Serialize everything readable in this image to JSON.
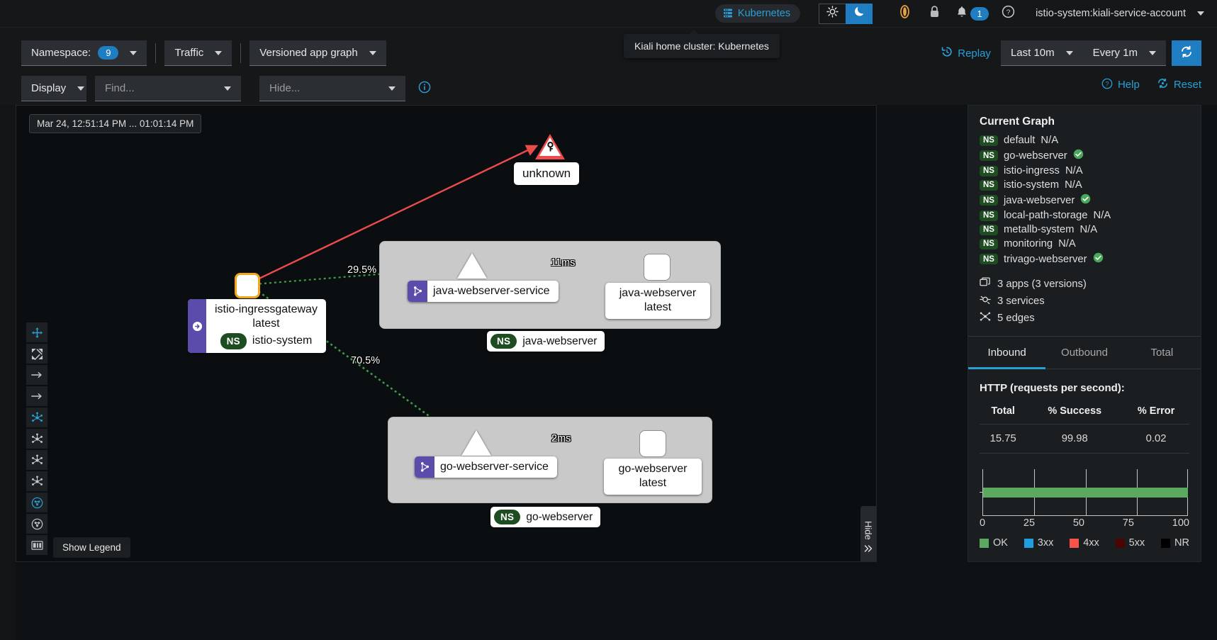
{
  "masthead": {
    "cluster_chip": "Kubernetes",
    "cluster_tooltip": "Kiali home cluster: Kubernetes",
    "theme_light_icon": "sun-icon",
    "theme_dark_icon": "moon-icon",
    "status_icon": "istio-status-icon",
    "lock_icon": "lock-icon",
    "bell_icon": "bell-icon",
    "notification_count": "1",
    "help_icon": "question-circle-icon",
    "user": "istio-system:kiali-service-account"
  },
  "toolbar": {
    "namespace_label": "Namespace:",
    "namespace_count": "9",
    "traffic_label": "Traffic",
    "graph_type": "Versioned app graph",
    "display_label": "Display",
    "find_placeholder": "Find...",
    "hide_placeholder": "Hide...",
    "info_icon": "info-circle-icon",
    "replay_label": "Replay",
    "duration": "Last 10m",
    "refresh_interval": "Every 1m",
    "refresh_icon": "sync-icon",
    "help_label": "Help",
    "reset_label": "Reset"
  },
  "graph": {
    "time_range_chip": "Mar 24, 12:51:14 PM ... 01:01:14 PM",
    "tools": [
      {
        "name": "drag-mode-button",
        "icon": "arrows-move-icon",
        "active": true
      },
      {
        "name": "fit-to-screen-button",
        "icon": "expand-icon",
        "active": false
      },
      {
        "name": "layout-dagre-lr-button",
        "icon": "arrow-right-icon",
        "active": false
      },
      {
        "name": "layout-grid-button",
        "icon": "arrow-right-icon",
        "active": false
      },
      {
        "name": "layout-cola-button",
        "icon": "topology-icon",
        "active": true
      },
      {
        "name": "layout-dagre-button",
        "icon": "topology-icon",
        "active": false
      },
      {
        "name": "layout-grid2-button",
        "icon": "topology-icon",
        "active": false
      },
      {
        "name": "layout-concentric-button",
        "icon": "topology-icon",
        "active": false
      },
      {
        "name": "namespace-layout-button",
        "icon": "circle-topology-icon",
        "active": true
      },
      {
        "name": "namespace-layout2-button",
        "icon": "circle-topology-icon",
        "active": false
      },
      {
        "name": "show-legend-button",
        "icon": "legend-icon",
        "active": false
      }
    ],
    "legend_tooltip": "Show Legend",
    "hide_handle_label": "Hide",
    "hide_handle_icon": "chevron-double-right-icon",
    "nodes": [
      {
        "id": "unknown",
        "label": "unknown",
        "type": "unknown-service",
        "shape": "triangle-alert"
      },
      {
        "id": "istio-ingressgateway",
        "label_line1": "istio-ingressgateway",
        "label_line2": "latest",
        "namespace": "istio-system",
        "ns_tag": "NS",
        "type": "gateway-app"
      },
      {
        "id": "java-webserver-service",
        "label": "java-webserver-service",
        "type": "service",
        "badge": "virtual-service-icon"
      },
      {
        "id": "java-webserver-app",
        "label_line1": "java-webserver",
        "label_line2": "latest",
        "type": "app-version"
      },
      {
        "id": "go-webserver-service",
        "label": "go-webserver-service",
        "type": "service",
        "badge": "virtual-service-icon"
      },
      {
        "id": "go-webserver-app",
        "label_line1": "go-webserver",
        "label_line2": "latest",
        "type": "app-version"
      }
    ],
    "boxes": [
      {
        "id": "java-webserver-box",
        "ns_pill": "NS",
        "label": "java-webserver"
      },
      {
        "id": "go-webserver-box",
        "ns_pill": "NS",
        "label": "go-webserver"
      }
    ],
    "edge_labels": [
      {
        "id": "edge-ingress-to-java",
        "text": "29.5%"
      },
      {
        "id": "edge-java-svc-to-app",
        "text": "11ms"
      },
      {
        "id": "edge-ingress-to-go",
        "text": "70.5%"
      },
      {
        "id": "edge-go-svc-to-app",
        "text": "2ms"
      }
    ]
  },
  "side": {
    "title": "Current Graph",
    "namespaces": [
      {
        "pill": "NS",
        "name": "default",
        "status": "N/A",
        "healthy": false
      },
      {
        "pill": "NS",
        "name": "go-webserver",
        "status": "",
        "healthy": true
      },
      {
        "pill": "NS",
        "name": "istio-ingress",
        "status": "N/A",
        "healthy": false
      },
      {
        "pill": "NS",
        "name": "istio-system",
        "status": "N/A",
        "healthy": false
      },
      {
        "pill": "NS",
        "name": "java-webserver",
        "status": "",
        "healthy": true
      },
      {
        "pill": "NS",
        "name": "local-path-storage",
        "status": "N/A",
        "healthy": false
      },
      {
        "pill": "NS",
        "name": "metallb-system",
        "status": "N/A",
        "healthy": false
      },
      {
        "pill": "NS",
        "name": "monitoring",
        "status": "N/A",
        "healthy": false
      },
      {
        "pill": "NS",
        "name": "trivago-webserver",
        "status": "",
        "healthy": true
      }
    ],
    "summary": [
      {
        "icon": "apps-icon",
        "text": "3 apps (3 versions)"
      },
      {
        "icon": "services-icon",
        "text": "3 services"
      },
      {
        "icon": "edges-icon",
        "text": "5 edges"
      }
    ],
    "tabs": [
      {
        "label": "Inbound",
        "active": true
      },
      {
        "label": "Outbound",
        "active": false
      },
      {
        "label": "Total",
        "active": false
      }
    ],
    "http_title": "HTTP (requests per second):",
    "metrics_headers": [
      "Total",
      "% Success",
      "% Error"
    ],
    "metrics_values": [
      "15.75",
      "99.98",
      "0.02"
    ],
    "chart_data": {
      "type": "bar",
      "title": "",
      "categories": [
        "OK"
      ],
      "values": [
        100
      ],
      "xlabel": "",
      "ylabel": "",
      "xlim": [
        0,
        100
      ],
      "ticks": [
        "0",
        "25",
        "50",
        "75",
        "100"
      ],
      "grid": true,
      "legend_position": "bottom",
      "series": [
        {
          "name": "OK",
          "value": 100,
          "color": "#5ba85f"
        },
        {
          "name": "3xx",
          "value": 0,
          "color": "#1f9fe0"
        },
        {
          "name": "4xx",
          "value": 0,
          "color": "#f8544a"
        },
        {
          "name": "5xx",
          "value": 0,
          "color": "#4a0404"
        },
        {
          "name": "NR",
          "value": 0,
          "color": "#000000"
        }
      ]
    }
  },
  "colors": {
    "accent": "#2a9fd6",
    "ok": "#5ba85f",
    "c3xx": "#1f9fe0",
    "c4xx": "#f8544a",
    "c5xx": "#4a0404",
    "nr": "#000000",
    "gateway": "#f0a818",
    "danger": "#ed4b4b"
  }
}
